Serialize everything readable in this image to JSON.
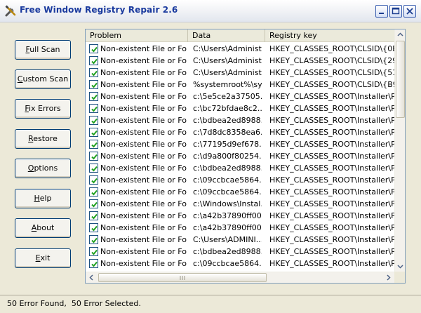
{
  "window": {
    "title": "Free Window Registry Repair 2.6",
    "icon": "tools-icon"
  },
  "buttons": [
    {
      "id": "full-scan",
      "pre": "",
      "key": "F",
      "post": "ull Scan"
    },
    {
      "id": "custom-scan",
      "pre": "",
      "key": "C",
      "post": "ustom Scan"
    },
    {
      "id": "fix-errors",
      "pre": "",
      "key": "F",
      "post": "ix Errors"
    },
    {
      "id": "restore",
      "pre": "",
      "key": "R",
      "post": "estore"
    },
    {
      "id": "options",
      "pre": "",
      "key": "O",
      "post": "ptions"
    },
    {
      "id": "help",
      "pre": "",
      "key": "H",
      "post": "elp"
    },
    {
      "id": "about",
      "pre": "",
      "key": "A",
      "post": "bout"
    },
    {
      "id": "exit",
      "pre": "",
      "key": "E",
      "post": "xit"
    }
  ],
  "list": {
    "columns": [
      "Problem",
      "Data",
      "Registry key"
    ],
    "rows": [
      {
        "checked": true,
        "problem": "Non-existent File or Folder",
        "data": "C:\\Users\\Administ...",
        "key": "HKEY_CLASSES_ROOT\\CLSID\\{0E"
      },
      {
        "checked": true,
        "problem": "Non-existent File or Folder",
        "data": "C:\\Users\\Administ...",
        "key": "HKEY_CLASSES_ROOT\\CLSID\\{29"
      },
      {
        "checked": true,
        "problem": "Non-existent File or Folder",
        "data": "C:\\Users\\Administ...",
        "key": "HKEY_CLASSES_ROOT\\CLSID\\{51"
      },
      {
        "checked": true,
        "problem": "Non-existent File or Folder",
        "data": "%systemroot%\\sys...",
        "key": "HKEY_CLASSES_ROOT\\CLSID\\{B9"
      },
      {
        "checked": true,
        "problem": "Non-existent File or Folder",
        "data": "c:\\5e5ce2a37505...",
        "key": "HKEY_CLASSES_ROOT\\Installer\\Pa"
      },
      {
        "checked": true,
        "problem": "Non-existent File or Folder",
        "data": "c:\\bc72bfdae8c2...",
        "key": "HKEY_CLASSES_ROOT\\Installer\\Pa"
      },
      {
        "checked": true,
        "problem": "Non-existent File or Folder",
        "data": "c:\\bdbea2ed8988...",
        "key": "HKEY_CLASSES_ROOT\\Installer\\Pa"
      },
      {
        "checked": true,
        "problem": "Non-existent File or Folder",
        "data": "c:\\7d8dc8358ea6...",
        "key": "HKEY_CLASSES_ROOT\\Installer\\Pa"
      },
      {
        "checked": true,
        "problem": "Non-existent File or Folder",
        "data": "c:\\77195d9ef678...",
        "key": "HKEY_CLASSES_ROOT\\Installer\\Pa"
      },
      {
        "checked": true,
        "problem": "Non-existent File or Folder",
        "data": "c:\\d9a800f80254...",
        "key": "HKEY_CLASSES_ROOT\\Installer\\Pa"
      },
      {
        "checked": true,
        "problem": "Non-existent File or Folder",
        "data": "c:\\bdbea2ed8988...",
        "key": "HKEY_CLASSES_ROOT\\Installer\\Pa"
      },
      {
        "checked": true,
        "problem": "Non-existent File or Folder",
        "data": "c:\\09ccbcae5864...",
        "key": "HKEY_CLASSES_ROOT\\Installer\\Pr"
      },
      {
        "checked": true,
        "problem": "Non-existent File or Folder",
        "data": "c:\\09ccbcae5864...",
        "key": "HKEY_CLASSES_ROOT\\Installer\\Pr"
      },
      {
        "checked": true,
        "problem": "Non-existent File or Folder",
        "data": "c:\\Windows\\Instal...",
        "key": "HKEY_CLASSES_ROOT\\Installer\\Pr"
      },
      {
        "checked": true,
        "problem": "Non-existent File or Folder",
        "data": "c:\\a42b37890ff00...",
        "key": "HKEY_CLASSES_ROOT\\Installer\\Pr"
      },
      {
        "checked": true,
        "problem": "Non-existent File or Folder",
        "data": "c:\\a42b37890ff00...",
        "key": "HKEY_CLASSES_ROOT\\Installer\\Pr"
      },
      {
        "checked": true,
        "problem": "Non-existent File or Folder",
        "data": "C:\\Users\\ADMINI...",
        "key": "HKEY_CLASSES_ROOT\\Installer\\Pr"
      },
      {
        "checked": true,
        "problem": "Non-existent File or Folder",
        "data": "c:\\bdbea2ed8988...",
        "key": "HKEY_CLASSES_ROOT\\Installer\\Pr"
      },
      {
        "checked": true,
        "problem": "Non-existent File or Folder",
        "data": "c:\\09ccbcae5864...",
        "key": "HKEY_CLASSES_ROOT\\Installer\\Pr"
      }
    ]
  },
  "status": {
    "text": "50 Error Found,  50 Error Selected."
  },
  "colors": {
    "title_text": "#1a3a9e",
    "face": "#ece9d8",
    "list_border": "#7f9db9"
  }
}
